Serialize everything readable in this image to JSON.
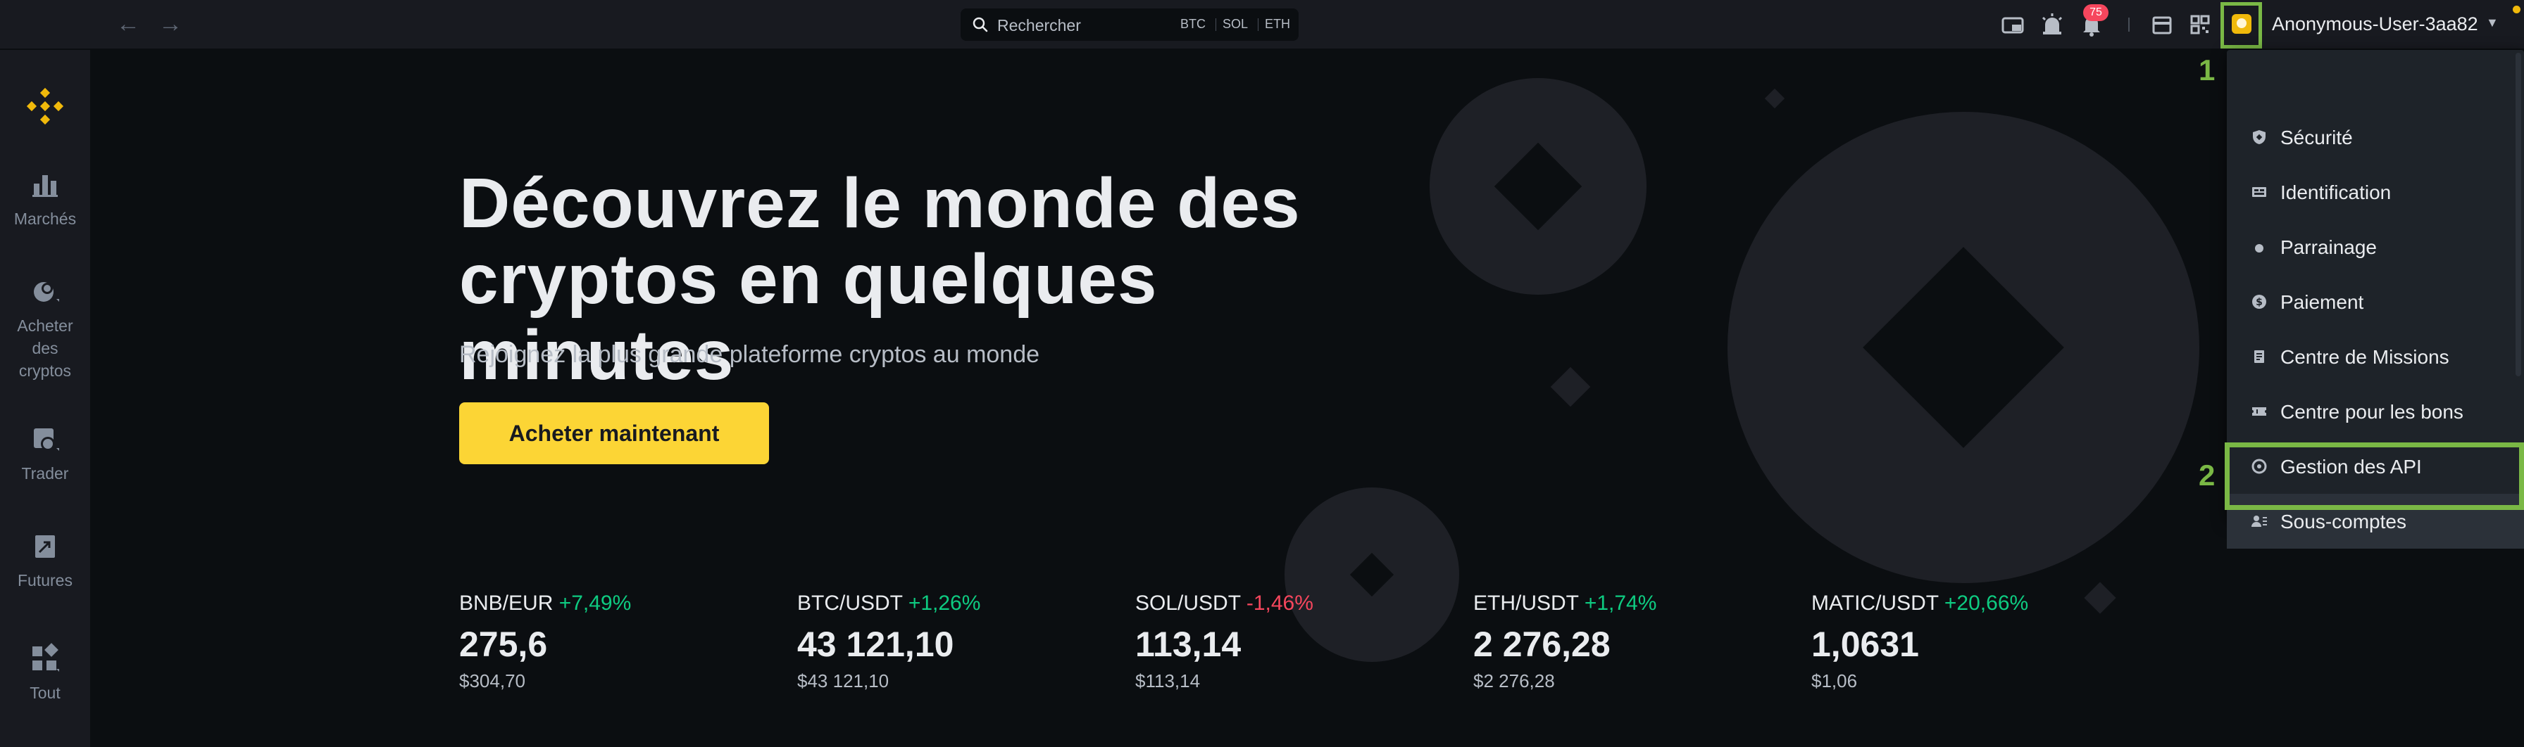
{
  "topbar": {
    "search_placeholder": "Rechercher",
    "chips": [
      "BTC",
      "SOL",
      "ETH"
    ],
    "notification_count": "75",
    "username": "Anonymous-User-3aa82"
  },
  "sidebar": {
    "items": [
      {
        "label": "Marchés",
        "icon": "bar-chart-icon"
      },
      {
        "label": "Acheter des cryptos",
        "label_lines": [
          "Acheter",
          "des",
          "cryptos"
        ],
        "icon": "coins-icon"
      },
      {
        "label": "Trader",
        "icon": "trade-icon"
      },
      {
        "label": "Futures",
        "icon": "futures-icon"
      },
      {
        "label": "Tout",
        "icon": "grid-icon"
      }
    ]
  },
  "hero": {
    "title_line1": "Découvrez le monde des",
    "title_line2": "cryptos en quelques minutes",
    "subtitle": "Rejoignez la plus grande plateforme cryptos au monde",
    "cta": "Acheter maintenant"
  },
  "tickers": [
    {
      "pair": "BNB/EUR",
      "change": "+7,49%",
      "price": "275,6",
      "fiat": "$304,70",
      "direction": "up"
    },
    {
      "pair": "BTC/USDT",
      "change": "+1,26%",
      "price": "43 121,10",
      "fiat": "$43 121,10",
      "direction": "up"
    },
    {
      "pair": "SOL/USDT",
      "change": "-1,46%",
      "price": "113,14",
      "fiat": "$113,14",
      "direction": "down"
    },
    {
      "pair": "ETH/USDT",
      "change": "+1,74%",
      "price": "2 276,28",
      "fiat": "$2 276,28",
      "direction": "up"
    },
    {
      "pair": "MATIC/USDT",
      "change": "+20,66%",
      "price": "1,0631",
      "fiat": "$1,06",
      "direction": "up"
    }
  ],
  "dropdown": {
    "items": [
      {
        "label": "Sécurité",
        "icon": "shield-icon"
      },
      {
        "label": "Identification",
        "icon": "id-card-icon"
      },
      {
        "label": "Parrainage",
        "icon": "referral-icon"
      },
      {
        "label": "Paiement",
        "icon": "payment-icon"
      },
      {
        "label": "Centre de Missions",
        "icon": "missions-icon"
      },
      {
        "label": "Centre pour les bons",
        "icon": "voucher-icon"
      },
      {
        "label": "Gestion des API",
        "icon": "api-icon"
      },
      {
        "label": "Sous-comptes",
        "icon": "sub-accounts-icon"
      }
    ],
    "active_index": 7
  },
  "annotations": {
    "step1": "1",
    "step2": "2"
  },
  "colors": {
    "brand": "#f0b90b",
    "cta": "#fcd535",
    "up": "#0ecb81",
    "down": "#f6465d",
    "annotation": "#7ab845"
  }
}
